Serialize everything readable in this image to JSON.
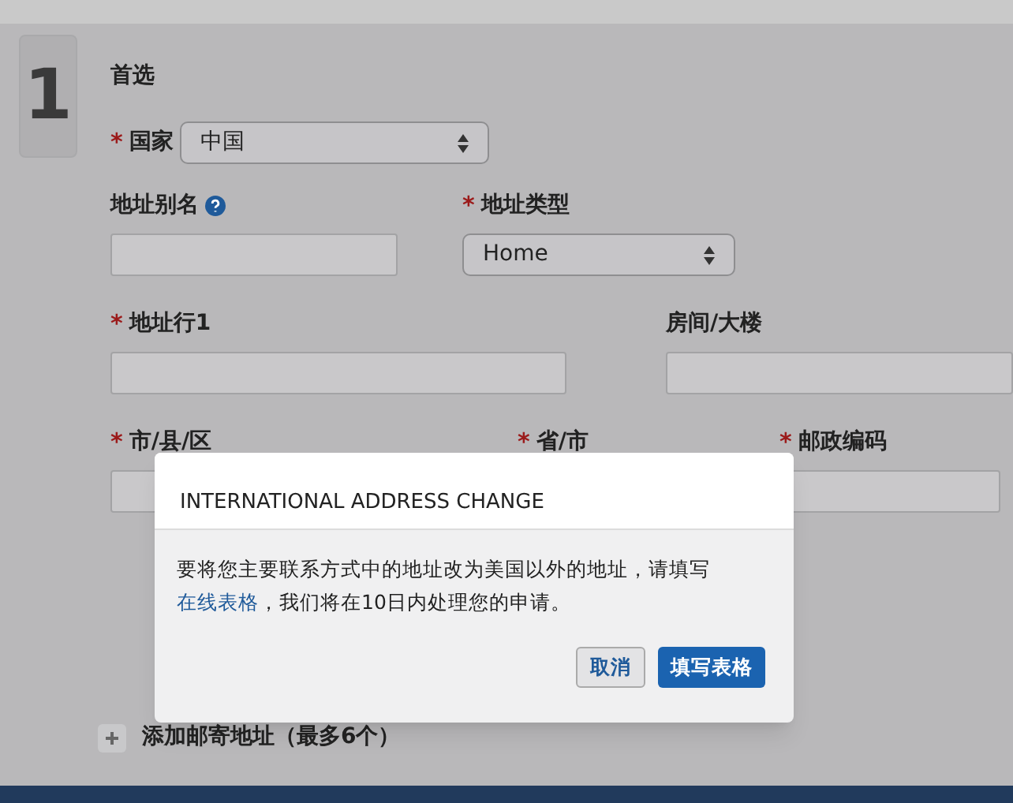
{
  "section": {
    "number": "1",
    "title": "首选"
  },
  "country": {
    "label": "国家",
    "required_mark": "*",
    "value": "中国"
  },
  "alias": {
    "label": "地址别名"
  },
  "address_type": {
    "label": "地址类型",
    "required_mark": "*",
    "value": "Home"
  },
  "address_line1": {
    "label": "地址行1",
    "required_mark": "*"
  },
  "room": {
    "label": "房间/大楼"
  },
  "city": {
    "label": "市/县/区",
    "required_mark": "*"
  },
  "province": {
    "label": "省/市",
    "required_mark": "*"
  },
  "postal": {
    "label": "邮政编码",
    "required_mark": "*"
  },
  "add_mailing": {
    "label": "添加邮寄地址（最多6个）"
  },
  "dialog": {
    "title": "INTERNATIONAL ADDRESS CHANGE",
    "text_before": "要将您主要联系方式中的地址改为美国以外的地址，请填写",
    "link": "在线表格",
    "text_after": "，我们将在10日内处理您的申请。",
    "buttons": [
      {
        "label": "取消",
        "kind": "secondary"
      },
      {
        "label": "填写表格",
        "kind": "primary"
      }
    ]
  }
}
